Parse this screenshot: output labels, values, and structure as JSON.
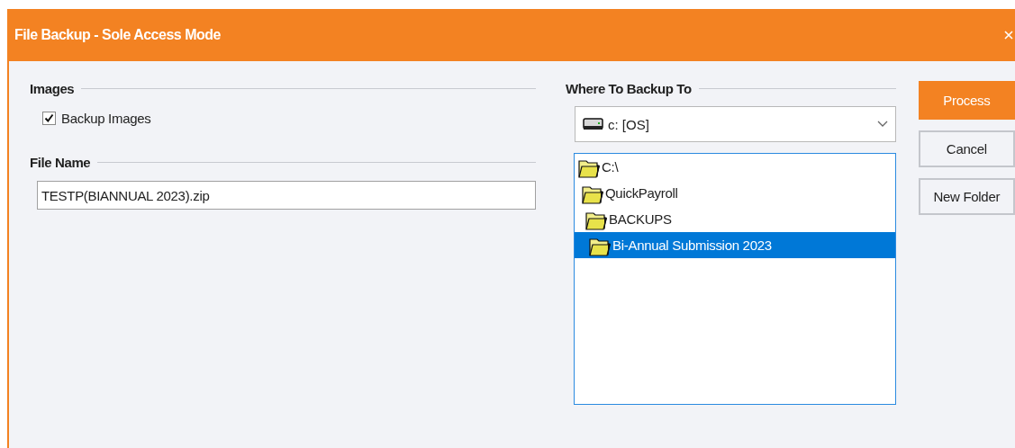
{
  "window": {
    "title": "File Backup - Sole Access Mode"
  },
  "images_group": {
    "label": "Images",
    "checkbox": {
      "label": "Backup Images",
      "checked": true
    }
  },
  "file_name_group": {
    "label": "File Name",
    "value": "TESTP(BIANNUAL 2023).zip"
  },
  "destination_group": {
    "label": "Where To Backup To",
    "drive": "c: [OS]",
    "folders": [
      {
        "name": "C:\\",
        "selected": false,
        "children": [
          {
            "name": "QuickPayroll",
            "selected": false,
            "children": [
              {
                "name": "BACKUPS",
                "selected": false,
                "children": [
                  {
                    "name": "Bi-Annual Submission 2023",
                    "selected": true
                  }
                ]
              }
            ]
          }
        ]
      }
    ]
  },
  "buttons": [
    {
      "label": "Process",
      "kind": "primary"
    },
    {
      "label": "Cancel",
      "kind": "normal"
    },
    {
      "label": "New Folder",
      "kind": "normal"
    }
  ]
}
